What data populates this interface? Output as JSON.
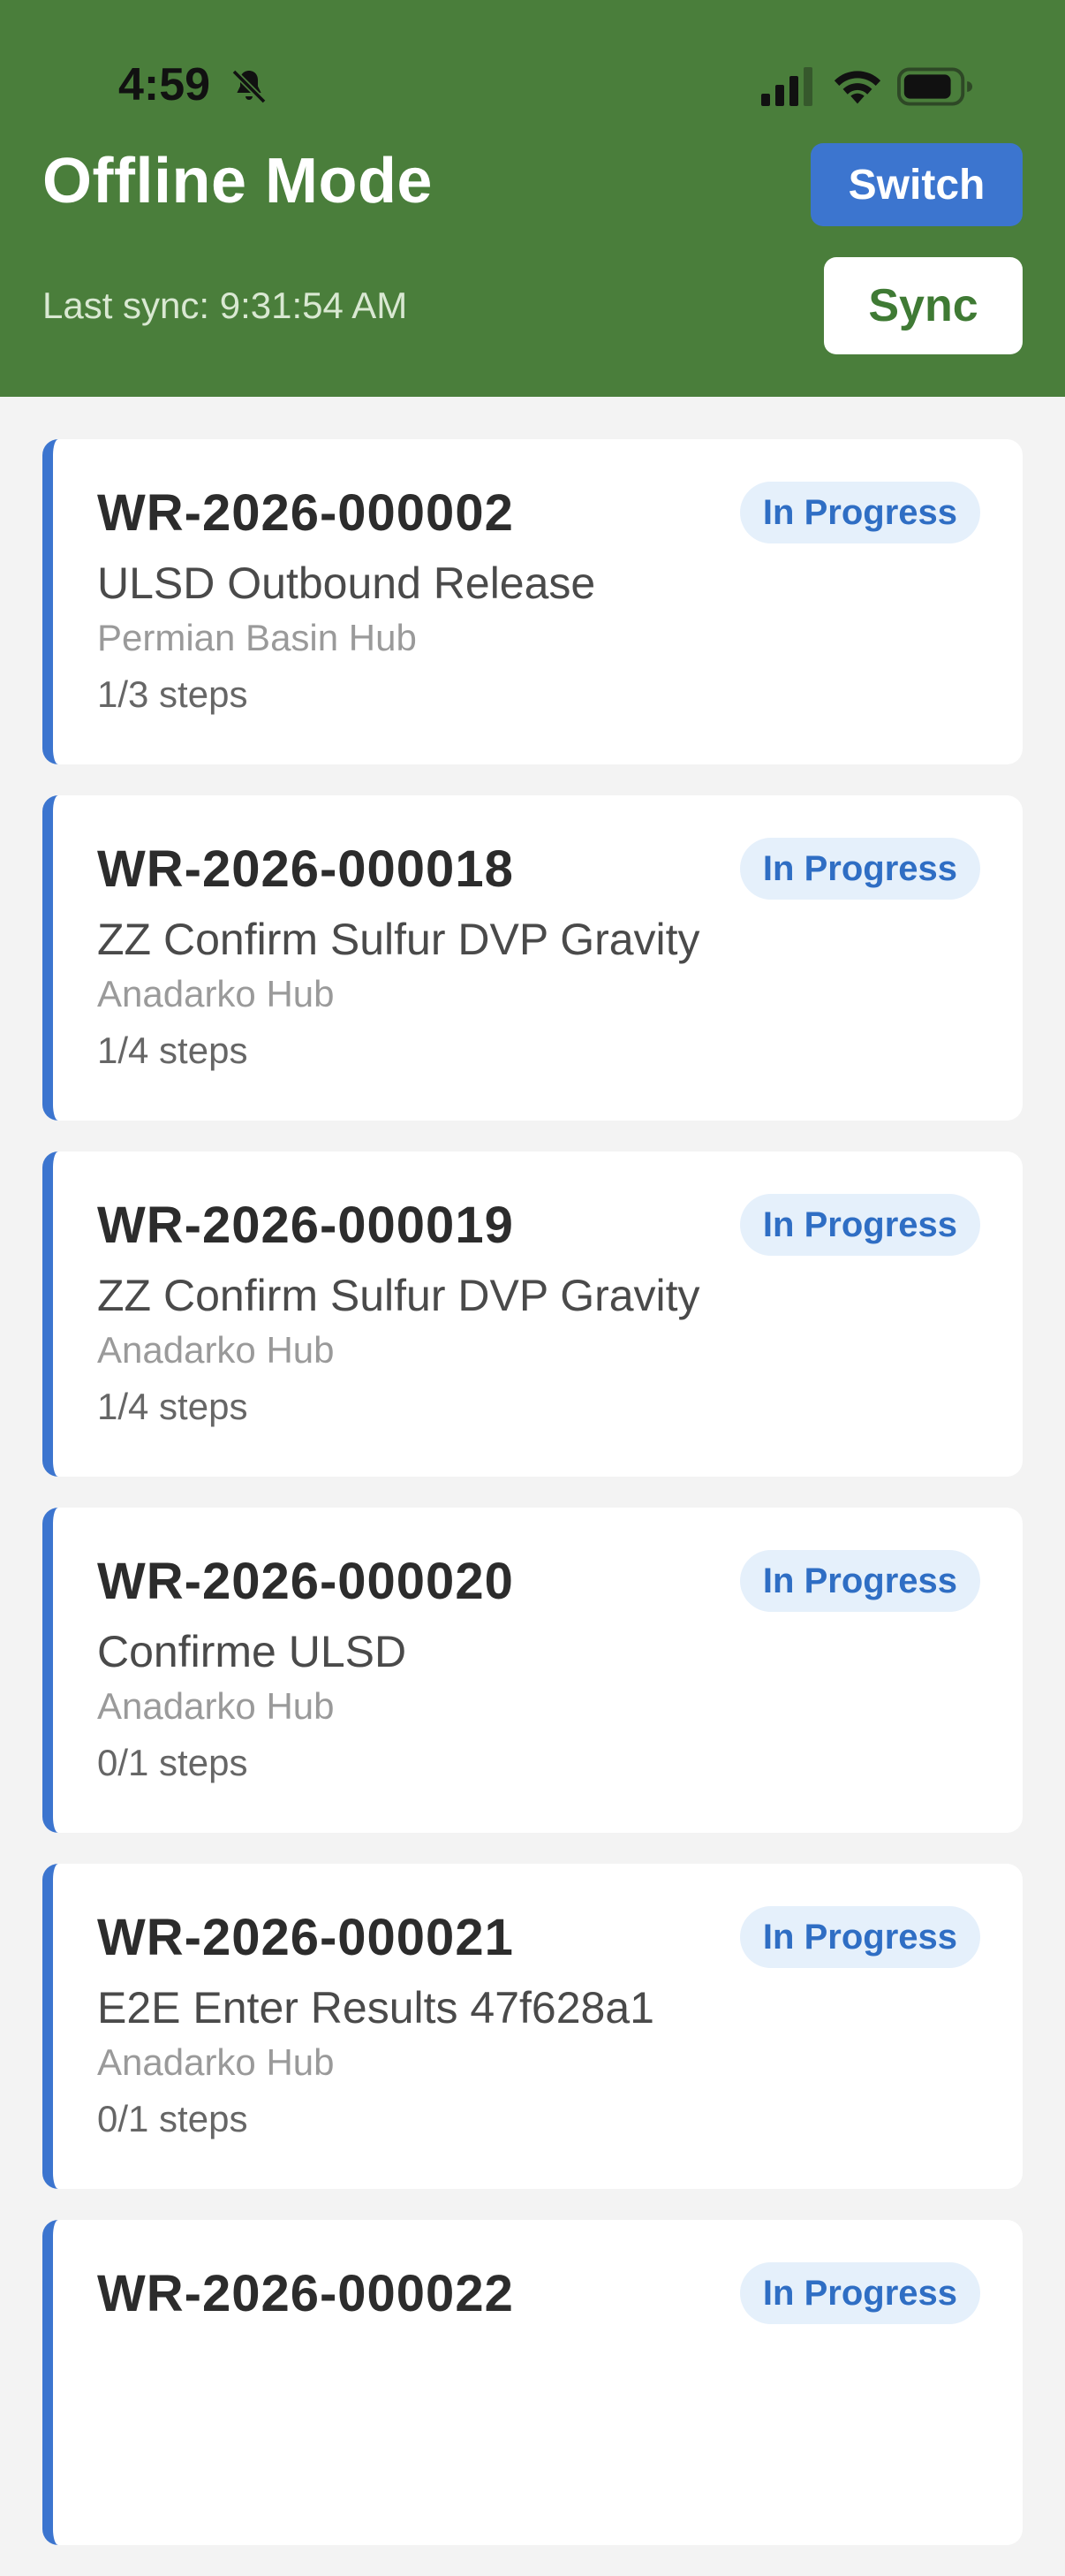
{
  "status_bar": {
    "time": "4:59"
  },
  "header": {
    "title": "Offline Mode",
    "switch_label": "Switch",
    "last_sync": "Last sync: 9:31:54 AM",
    "sync_label": "Sync",
    "colors": {
      "background": "#4a7e3b",
      "switch": "#3c75cf",
      "sync_text": "#3f7a34"
    }
  },
  "work_requests": [
    {
      "id": "WR-2026-000002",
      "status": "In Progress",
      "name": "ULSD Outbound Release",
      "hub": "Permian Basin Hub",
      "steps": "1/3 steps"
    },
    {
      "id": "WR-2026-000018",
      "status": "In Progress",
      "name": "ZZ Confirm Sulfur DVP Gravity",
      "hub": "Anadarko Hub",
      "steps": "1/4 steps"
    },
    {
      "id": "WR-2026-000019",
      "status": "In Progress",
      "name": "ZZ Confirm Sulfur DVP Gravity",
      "hub": "Anadarko Hub",
      "steps": "1/4 steps"
    },
    {
      "id": "WR-2026-000020",
      "status": "In Progress",
      "name": "Confirme ULSD",
      "hub": "Anadarko Hub",
      "steps": "0/1 steps"
    },
    {
      "id": "WR-2026-000021",
      "status": "In Progress",
      "name": "E2E Enter Results 47f628a1",
      "hub": "Anadarko Hub",
      "steps": "0/1 steps"
    },
    {
      "id": "WR-2026-000022",
      "status": "In Progress",
      "name": "",
      "hub": "",
      "steps": ""
    }
  ],
  "icons": [
    "bell-off-icon",
    "cellular-signal-icon",
    "wifi-icon",
    "battery-icon"
  ],
  "accent_color": "#3c75cf"
}
